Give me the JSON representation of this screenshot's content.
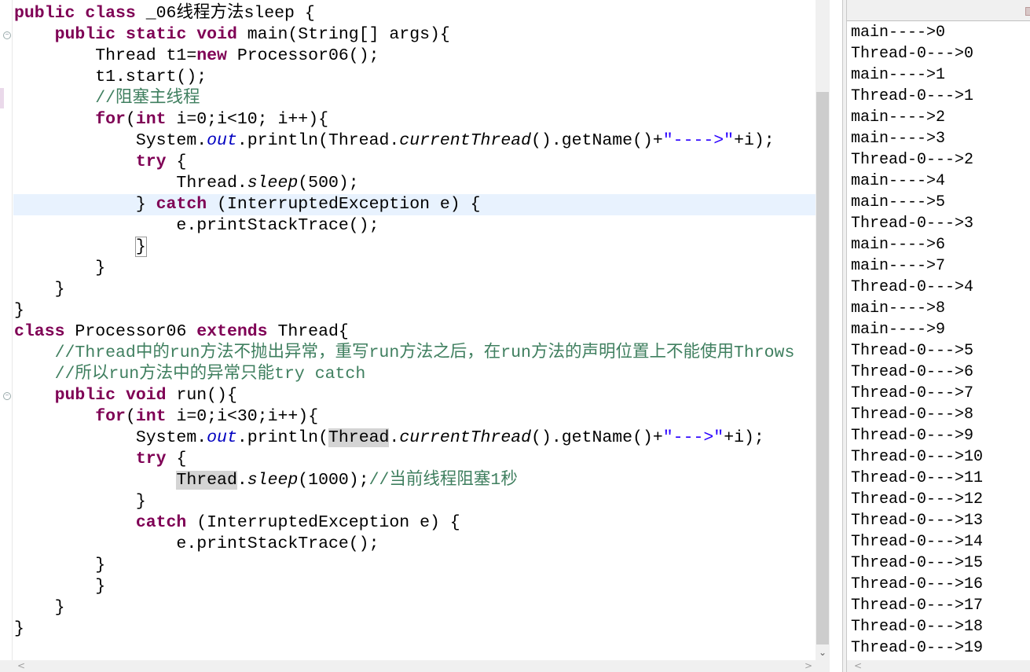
{
  "editor": {
    "current_line": 10,
    "lines": [
      [
        [
          "k",
          "public"
        ],
        [
          "t",
          " "
        ],
        [
          "k",
          "class"
        ],
        [
          "t",
          " _06线程方法sleep {"
        ]
      ],
      [
        [
          "t",
          "    "
        ],
        [
          "k",
          "public"
        ],
        [
          "t",
          " "
        ],
        [
          "k",
          "static"
        ],
        [
          "t",
          " "
        ],
        [
          "k",
          "void"
        ],
        [
          "t",
          " main(String[] args){"
        ]
      ],
      [
        [
          "t",
          "        Thread t1="
        ],
        [
          "k",
          "new"
        ],
        [
          "t",
          " Processor06();"
        ]
      ],
      [
        [
          "t",
          "        t1.start();"
        ]
      ],
      [
        [
          "t",
          "        "
        ],
        [
          "c",
          "//阻塞主线程"
        ]
      ],
      [
        [
          "t",
          "        "
        ],
        [
          "k",
          "for"
        ],
        [
          "t",
          "("
        ],
        [
          "k",
          "int"
        ],
        [
          "t",
          " i=0;i<10; i++){"
        ]
      ],
      [
        [
          "t",
          "            System."
        ],
        [
          "f",
          "out"
        ],
        [
          "t",
          ".println(Thread."
        ],
        [
          "m",
          "currentThread"
        ],
        [
          "t",
          "().getName()+"
        ],
        [
          "s",
          "\"---->\""
        ],
        [
          "t",
          "+i);"
        ]
      ],
      [
        [
          "t",
          "            "
        ],
        [
          "k",
          "try"
        ],
        [
          "t",
          " {"
        ]
      ],
      [
        [
          "t",
          "                Thread."
        ],
        [
          "m",
          "sleep"
        ],
        [
          "t",
          "(500);"
        ]
      ],
      [
        [
          "t",
          "            } "
        ],
        [
          "k",
          "catch"
        ],
        [
          "t",
          " (InterruptedException e) {"
        ]
      ],
      [
        [
          "t",
          "                e.printStackTrace();"
        ]
      ],
      [
        [
          "t",
          "            "
        ],
        [
          "b",
          "}"
        ]
      ],
      [
        [
          "t",
          "        }"
        ]
      ],
      [
        [
          "t",
          "    }"
        ]
      ],
      [
        [
          "t",
          "}"
        ]
      ],
      [
        [
          "k",
          "class"
        ],
        [
          "t",
          " Processor06 "
        ],
        [
          "k",
          "extends"
        ],
        [
          "t",
          " Thread{"
        ]
      ],
      [
        [
          "t",
          "    "
        ],
        [
          "c",
          "//Thread中的run方法不抛出异常，重写run方法之后，在run方法的声明位置上不能使用Throws"
        ]
      ],
      [
        [
          "t",
          "    "
        ],
        [
          "c",
          "//所以run方法中的异常只能try catch"
        ]
      ],
      [
        [
          "t",
          "    "
        ],
        [
          "k",
          "public"
        ],
        [
          "t",
          " "
        ],
        [
          "k",
          "void"
        ],
        [
          "t",
          " run(){"
        ]
      ],
      [
        [
          "t",
          "        "
        ],
        [
          "k",
          "for"
        ],
        [
          "t",
          "("
        ],
        [
          "k",
          "int"
        ],
        [
          "t",
          " i=0;i<30;i++){"
        ]
      ],
      [
        [
          "t",
          "            System."
        ],
        [
          "f",
          "out"
        ],
        [
          "t",
          ".println("
        ],
        [
          "h",
          "Thread"
        ],
        [
          "t",
          "."
        ],
        [
          "m",
          "currentThread"
        ],
        [
          "t",
          "().getName()+"
        ],
        [
          "s",
          "\"--->\""
        ],
        [
          "t",
          "+i);"
        ]
      ],
      [
        [
          "t",
          "            "
        ],
        [
          "k",
          "try"
        ],
        [
          "t",
          " {"
        ]
      ],
      [
        [
          "t",
          "                "
        ],
        [
          "h",
          "Thread"
        ],
        [
          "t",
          "."
        ],
        [
          "m",
          "sleep"
        ],
        [
          "t",
          "(1000);"
        ],
        [
          "c",
          "//当前线程阻塞1秒"
        ]
      ],
      [
        [
          "t",
          "            }"
        ]
      ],
      [
        [
          "t",
          "            "
        ],
        [
          "k",
          "catch"
        ],
        [
          "t",
          " (InterruptedException e) {"
        ]
      ],
      [
        [
          "t",
          "                e.printStackTrace();"
        ]
      ],
      [
        [
          "t",
          "        }"
        ]
      ],
      [
        [
          "t",
          "        }"
        ]
      ],
      [
        [
          "t",
          "    }"
        ]
      ],
      [
        [
          "t",
          "}"
        ]
      ]
    ]
  },
  "console": {
    "lines": [
      "main---->0",
      "Thread-0--->0",
      "main---->1",
      "Thread-0--->1",
      "main---->2",
      "main---->3",
      "Thread-0--->2",
      "main---->4",
      "main---->5",
      "Thread-0--->3",
      "main---->6",
      "main---->7",
      "Thread-0--->4",
      "main---->8",
      "main---->9",
      "Thread-0--->5",
      "Thread-0--->6",
      "Thread-0--->7",
      "Thread-0--->8",
      "Thread-0--->9",
      "Thread-0--->10",
      "Thread-0--->11",
      "Thread-0--->12",
      "Thread-0--->13",
      "Thread-0--->14",
      "Thread-0--->15",
      "Thread-0--->16",
      "Thread-0--->17",
      "Thread-0--->18",
      "Thread-0--->19"
    ]
  },
  "icons": {
    "fold": "⊖",
    "down": "⌄",
    "left": "<",
    "right": ">"
  }
}
